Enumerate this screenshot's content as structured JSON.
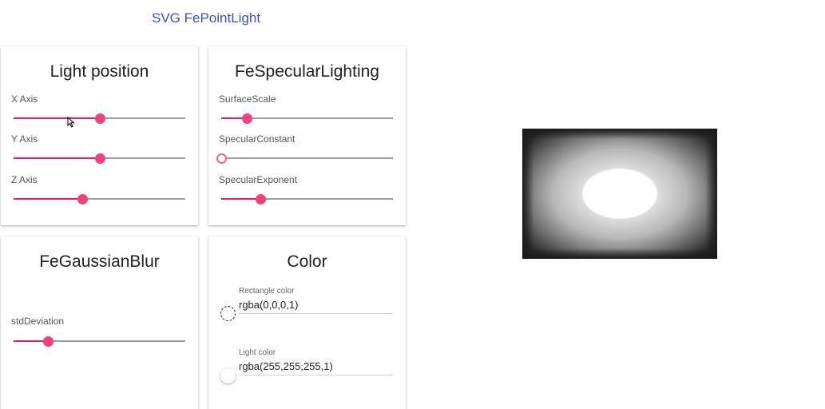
{
  "app": {
    "title": "SVG FePointLight"
  },
  "light_position": {
    "title": "Light position",
    "x_label": "X Axis",
    "x_value": 0.5,
    "y_label": "Y Axis",
    "y_value": 0.5,
    "z_label": "Z Axis",
    "z_value": 0.4
  },
  "specular": {
    "title": "FeSpecularLighting",
    "surface_label": "SurfaceScale",
    "surface_value": 0.15,
    "constant_label": "SpecularConstant",
    "constant_value": 0.0,
    "exponent_label": "SpecularExponent",
    "exponent_value": 0.23
  },
  "blur": {
    "title": "FeGaussianBlur",
    "std_label": "stdDeviation",
    "std_value": 0.2
  },
  "color": {
    "title": "Color",
    "rect_label": "Rectangle color",
    "rect_value": "rgba(0,0,0,1)",
    "light_label": "Light color",
    "light_value": "rgba(255,255,255,1)"
  },
  "theme": {
    "accent": "#e91e63",
    "title_color": "#3f51b5"
  }
}
